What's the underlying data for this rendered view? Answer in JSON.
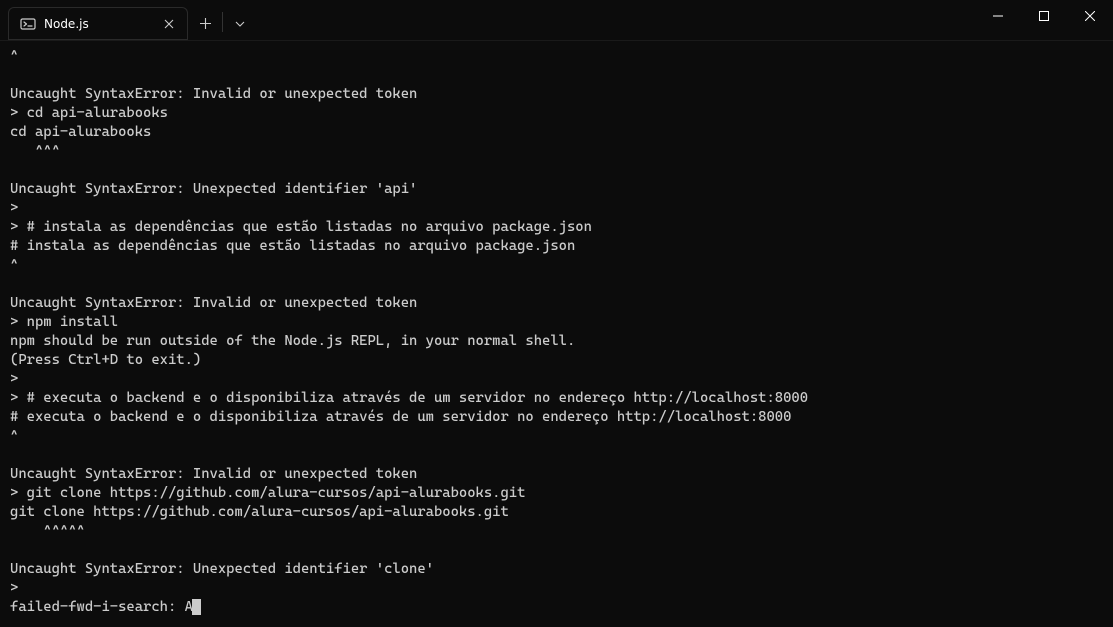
{
  "tab": {
    "title": "Node.js"
  },
  "lines": [
    "^",
    "",
    "Uncaught SyntaxError: Invalid or unexpected token",
    "> cd api-alurabooks",
    "cd api-alurabooks",
    "   ^^^",
    "",
    "Uncaught SyntaxError: Unexpected identifier 'api'",
    ">",
    "> # instala as dependências que estão listadas no arquivo package.json",
    "# instala as dependências que estão listadas no arquivo package.json",
    "^",
    "",
    "Uncaught SyntaxError: Invalid or unexpected token",
    "> npm install",
    "npm should be run outside of the Node.js REPL, in your normal shell.",
    "(Press Ctrl+D to exit.)",
    ">",
    "> # executa o backend e o disponibiliza através de um servidor no endereço http://localhost:8000",
    "# executa o backend e o disponibiliza através de um servidor no endereço http://localhost:8000",
    "^",
    "",
    "Uncaught SyntaxError: Invalid or unexpected token",
    "> git clone https://github.com/alura-cursos/api-alurabooks.git",
    "git clone https://github.com/alura-cursos/api-alurabooks.git",
    "    ^^^^^",
    "",
    "Uncaught SyntaxError: Unexpected identifier 'clone'",
    ">",
    "failed-fwd-i-search: A_"
  ]
}
